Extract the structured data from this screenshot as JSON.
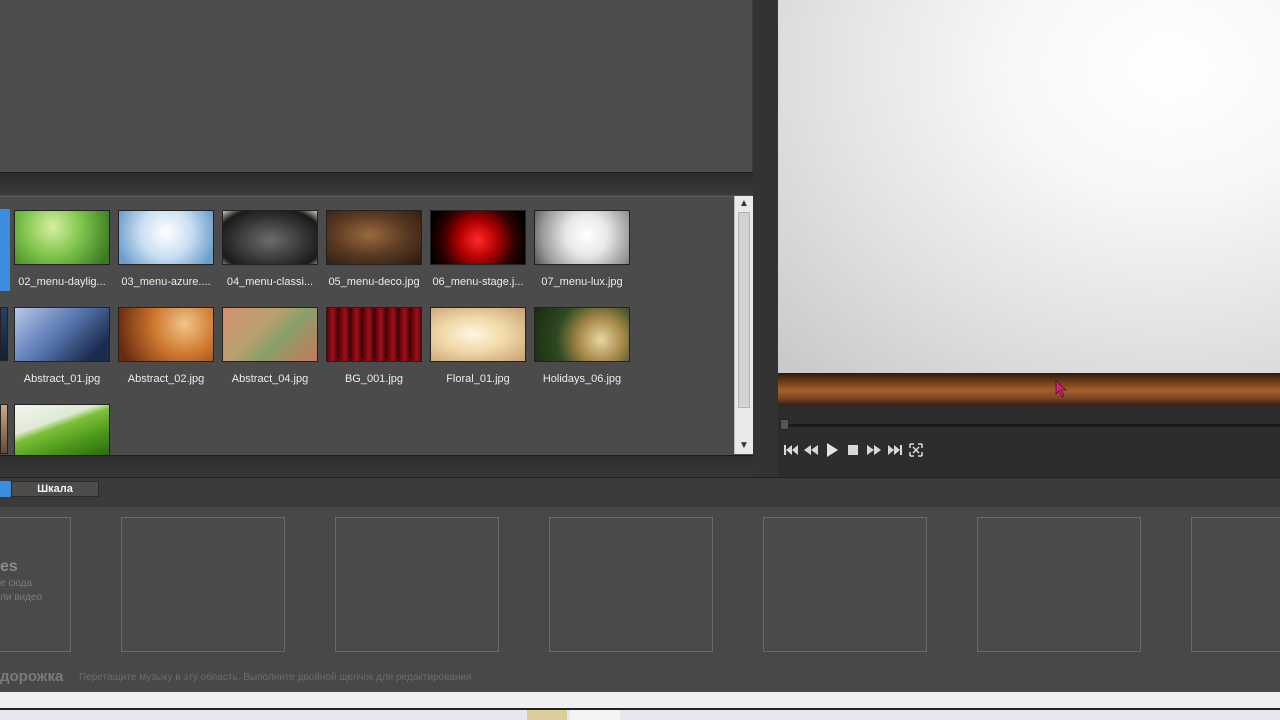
{
  "library": {
    "row1": [
      {
        "caption": "02_menu-daylig..."
      },
      {
        "caption": "03_menu-azure...."
      },
      {
        "caption": "04_menu-classi..."
      },
      {
        "caption": "05_menu-deco.jpg"
      },
      {
        "caption": "06_menu-stage.j..."
      },
      {
        "caption": "07_menu-lux.jpg"
      }
    ],
    "row2": [
      {
        "caption": "Abstract_01.jpg"
      },
      {
        "caption": "Abstract_02.jpg"
      },
      {
        "caption": "Abstract_04.jpg"
      },
      {
        "caption": "BG_001.jpg"
      },
      {
        "caption": "Floral_01.jpg"
      },
      {
        "caption": "Holidays_06.jpg"
      }
    ]
  },
  "tabs": {
    "scale": "Шкала"
  },
  "storyboard": {
    "hint_title": "es",
    "hint_line1": "е сюда",
    "hint_line2": "ли видео"
  },
  "audio": {
    "label": "дорожка",
    "hint": "Перетащите музыку в эту область. Выполните двойной щелчок для редактирования"
  },
  "transport": {
    "icons": [
      "skip-start-icon",
      "rewind-icon",
      "play-icon",
      "stop-icon",
      "fast-forward-icon",
      "skip-end-icon",
      "fullscreen-icon"
    ]
  },
  "colors": {
    "accent": "#3b8dde",
    "cursor": "#d0207a"
  }
}
